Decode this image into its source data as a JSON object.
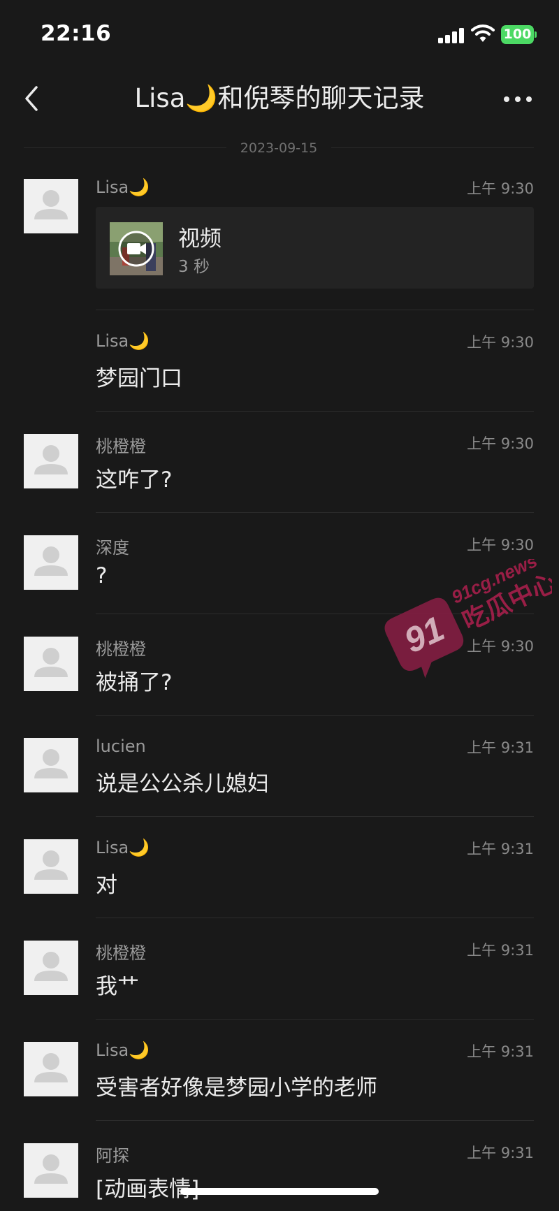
{
  "status": {
    "time": "22:16",
    "battery": "100"
  },
  "nav": {
    "title": "Lisa🌙和倪琴的聊天记录"
  },
  "date_divider": "2023-09-15",
  "video": {
    "label": "视频",
    "duration": "3 秒"
  },
  "messages": [
    {
      "sender": "Lisa🌙",
      "time": "上午 9:30",
      "text": ""
    },
    {
      "sender": "Lisa🌙",
      "time": "上午 9:30",
      "text": "梦园门口"
    },
    {
      "sender": "桃橙橙",
      "time": "上午 9:30",
      "text": "这咋了?"
    },
    {
      "sender": "深度",
      "time": "上午 9:30",
      "text": "?"
    },
    {
      "sender": "桃橙橙",
      "time": "上午 9:30",
      "text": "被捅了?"
    },
    {
      "sender": "lucien",
      "time": "上午 9:31",
      "text": "说是公公杀儿媳妇"
    },
    {
      "sender": "Lisa🌙",
      "time": "上午 9:31",
      "text": "对"
    },
    {
      "sender": "桃橙橙",
      "time": "上午 9:31",
      "text": "我艹"
    },
    {
      "sender": "Lisa🌙",
      "time": "上午 9:31",
      "text": "受害者好像是梦园小学的老师"
    },
    {
      "sender": "阿探",
      "time": "上午 9:31",
      "text": "[动画表情]"
    }
  ],
  "watermark": {
    "number": "91",
    "domain": "91cg.news",
    "brand": "吃瓜中心"
  }
}
